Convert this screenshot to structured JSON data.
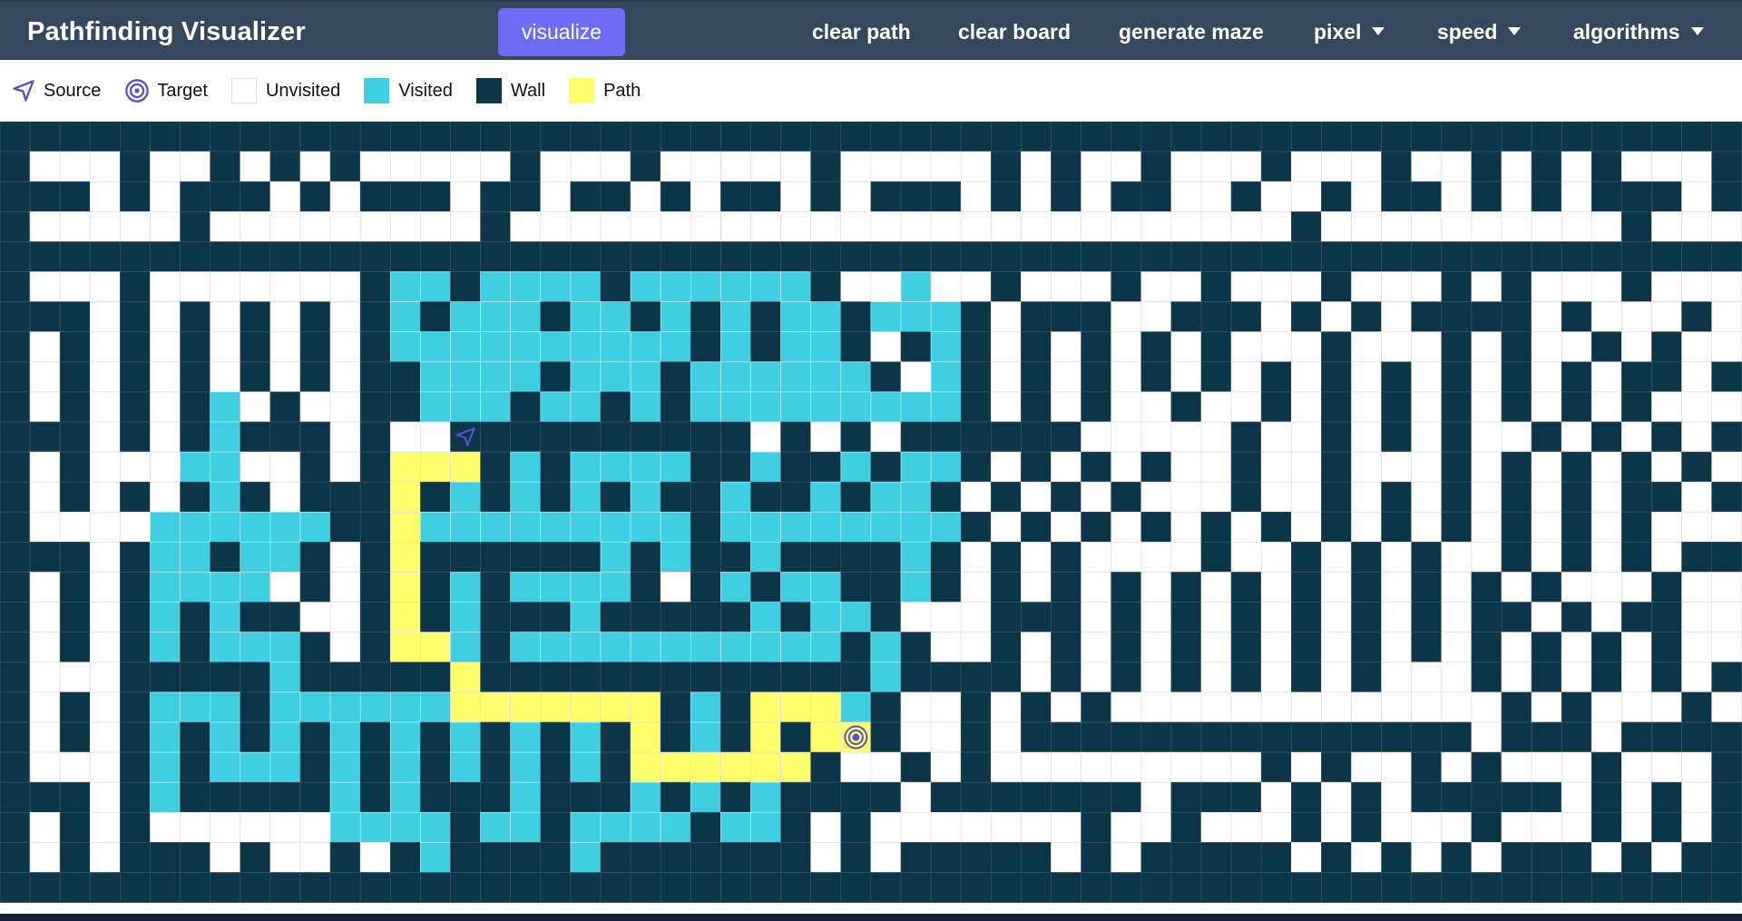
{
  "header": {
    "title": "Pathfinding Visualizer",
    "visualize_label": "visualize",
    "clear_path_label": "clear path",
    "clear_board_label": "clear board",
    "generate_maze_label": "generate maze",
    "pixel_label": "pixel",
    "speed_label": "speed",
    "algorithms_label": "algorithms"
  },
  "legend": {
    "source": "Source",
    "target": "Target",
    "unvisited": "Unvisited",
    "visited": "Visited",
    "wall": "Wall",
    "path": "Path"
  },
  "colors": {
    "navbar": "#34495e",
    "button": "#6c6cf7",
    "wall": "#0c3547",
    "visited": "#40cee3",
    "path": "#fffe6a",
    "unvisited": "#ffffff",
    "gridline": "#dcdcf0",
    "icon": "#5b4fd6"
  },
  "grid": {
    "rows": 26,
    "cols": 58,
    "source": [
      10,
      15
    ],
    "target": [
      20,
      28
    ],
    "cells": [
      "##########################################################",
      "#...#..#.#.#.....#...#.....#.....#.#..#...#...#..#.#.#...#",
      "###.#.###.#.###.##.##.#.##.#.###.#.#.##..#..#.##.#.#.###.#",
      "#.....#.........#..........................#..........#...#",
      "##########################################################",
      "#...#.......#vv#vvvv#vvvvvv#..v..#...#..#...#...#.#...#...#",
      "###.#.#.#.#.#v#vvv#vv#v#v#vv#vvv#.###..###.#.#.####.#...#.",
      "#.#.#.#.#.#.#vvvvvvvvvv#v#vv#.#v#.#.#.#.#...#...#.#..#.#..",
      "#.#.#.#.#.#.##vvvv#vvv#vvvvvv#.v#.#.#.#.#.#.#.#.#.#.#.##.#",
      "#.#.#.#v.#..##vvv#vv#v#vvvvvvvvv#.#.#..#..#.#.#.#.#.#.#...",
      "###.#.#v###.#.S##########.#.#.######.....#..#.#.#..#.#.#.#",
      "#.#...vv..#.#PPP#v#vvvv##v##v#vv#.#.#.#..#..#...#.#.#.#.#.",
      "#.#.#.#v#.###P#v#v#v#v##v##v#vv#.#.#.#...#..#.#.#.#.#.##.#",
      "#....vvvvvv##Pvvvvvvvvv#vvvvvvvv#.#.#.#.#.#.#.#.#.#.#.#...",
      "###.#vv#vv#.#P######v#v##v####v#.#.#....#..#.#.#..#.#.#.##",
      "#.#.#vvvv.#.#P#v#vvvv#.#v#vv##v#.#.#.#.#.#.#.#.#.#.#...#.",
      "#.#.#v#v##..#P#v###v#####v#vv#...###.#.#.#.#.#.#.##.#.##.",
      "#.#.#v#vvv#.#PPv#vvvvvvvvvvv#v#..#.#.#.#.#.#.#.#.#.#.#.#..",
      "#...#####v#####P#############v####.#.#.#.#.#.#...#.#.#.#.#",
      "#.#.#vvv#vvvvvvPPPPPPP#v#PPPv#..#.#.#.............#.#...#.",
      "#.#.#v#v#v#v#v#v#v#v#P#v#P#PT#..#.###############.###.####",
      "#...#v#vvv#v#v#v#v#v#PPPPPP#..#.#.........#.#..#.#...#...#",
      "###.#v#####v#v###v###v#v#v####.#######.###.#.#.#####.#.#.#",
      "#.#.#......vvvv#vv#vvvv#vv#.#.......#..#...#.#...#...#.#.#",
      "#.#.###.#..#.#v####v#######.#.#####.#.#####.#.#.#.###.#.##",
      "##########################################################"
    ]
  }
}
